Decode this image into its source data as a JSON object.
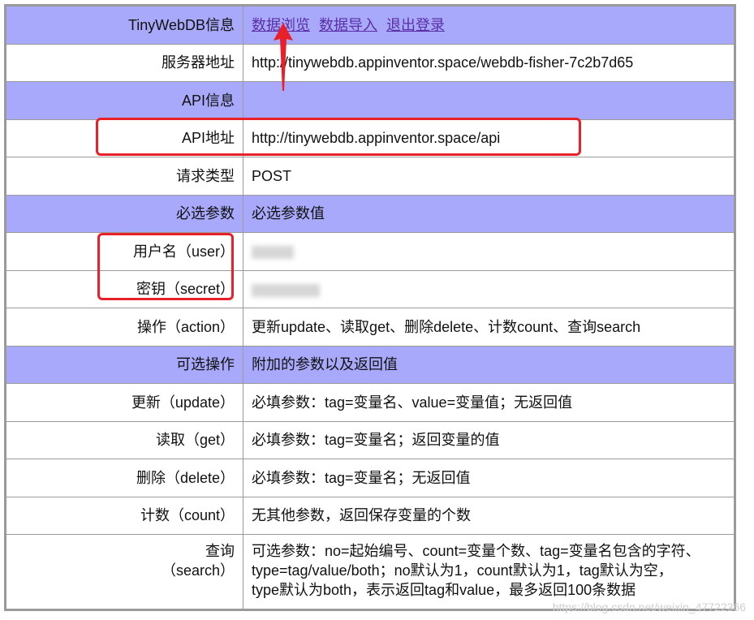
{
  "colors": {
    "header_bg": "#a9a9fb",
    "border": "#9a9a9a",
    "link": "#5a2ea6",
    "callout": "#e8202a"
  },
  "info": {
    "label": "TinyWebDB信息",
    "links": [
      "数据浏览",
      "数据导入",
      "退出登录"
    ]
  },
  "server": {
    "label": "服务器地址",
    "value": "http://tinywebdb.appinventor.space/webdb-fisher-7c2b7d65"
  },
  "api_info": {
    "label": "API信息"
  },
  "api_url": {
    "label": "API地址",
    "value": "http://tinywebdb.appinventor.space/api"
  },
  "request_type": {
    "label": "请求类型",
    "value": "POST"
  },
  "required_header": {
    "label": "必选参数",
    "value": "必选参数值"
  },
  "user": {
    "label": "用户名（user）"
  },
  "secret": {
    "label": "密钥（secret）"
  },
  "action": {
    "label": "操作（action）",
    "value": "更新update、读取get、删除delete、计数count、查询search"
  },
  "optional_header": {
    "label": "可选操作",
    "value": "附加的参数以及返回值"
  },
  "update": {
    "label": "更新（update）",
    "value": "必填参数：tag=变量名、value=变量值；无返回值"
  },
  "get": {
    "label": "读取（get）",
    "value": "必填参数：tag=变量名；返回变量的值"
  },
  "delete": {
    "label": "删除（delete）",
    "value": "必填参数：tag=变量名；无返回值"
  },
  "count": {
    "label": "计数（count）",
    "value": "无其他参数，返回保存变量的个数"
  },
  "search": {
    "label_line1": "查询",
    "label_line2": "（search）",
    "lines": [
      "可选参数：no=起始编号、count=变量个数、tag=变量名包含的字符、",
      "type=tag/value/both；no默认为1，count默认为1，tag默认为空，",
      "type默认为both，表示返回tag和value，最多返回100条数据"
    ]
  },
  "watermark": "https://blog.csdn.net/weixin_47722366"
}
